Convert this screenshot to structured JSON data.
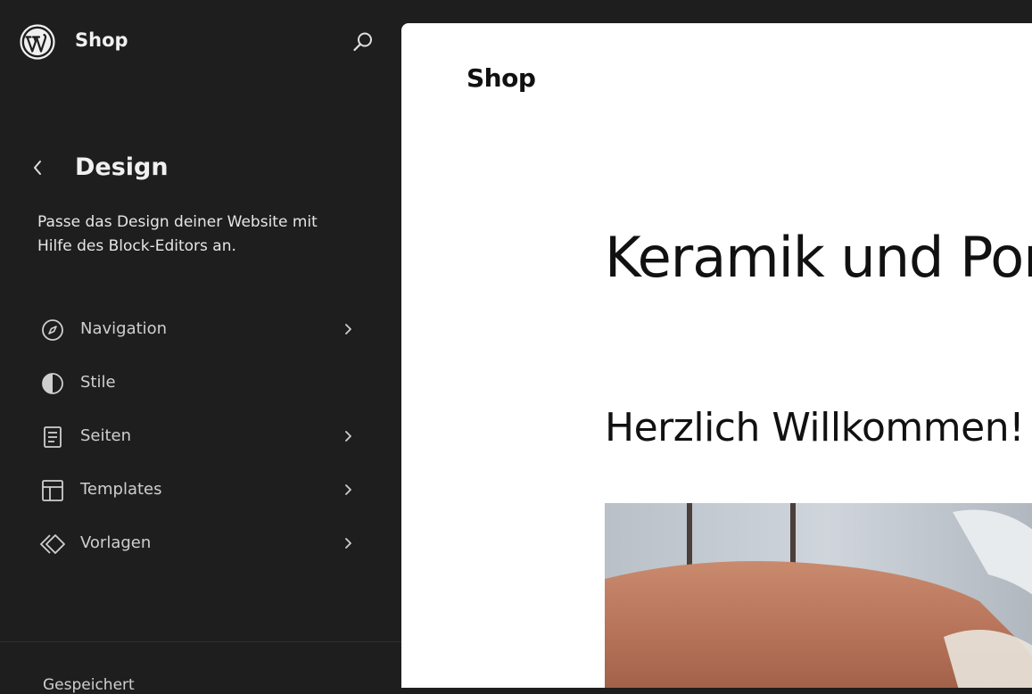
{
  "sidebar": {
    "site_title": "Shop",
    "section_title": "Design",
    "description": "Passe das Design deiner Website mit Hilfe des Block-Editors an.",
    "items": [
      {
        "label": "Navigation",
        "icon": "compass-icon",
        "has_chevron": true
      },
      {
        "label": "Stile",
        "icon": "half-circle-icon",
        "has_chevron": false
      },
      {
        "label": "Seiten",
        "icon": "page-icon",
        "has_chevron": true
      },
      {
        "label": "Templates",
        "icon": "layout-icon",
        "has_chevron": true
      },
      {
        "label": "Vorlagen",
        "icon": "diamond-icon",
        "has_chevron": true
      }
    ],
    "bottom_link": "Gespeichert"
  },
  "canvas": {
    "site_title": "Shop",
    "hero_heading": "Keramik und Porz",
    "welcome_heading": "Herzlich Willkommen!"
  },
  "colors": {
    "sidebar_bg": "#1e1e1e",
    "canvas_bg": "#ffffff",
    "text_light": "#e0e0e0"
  }
}
